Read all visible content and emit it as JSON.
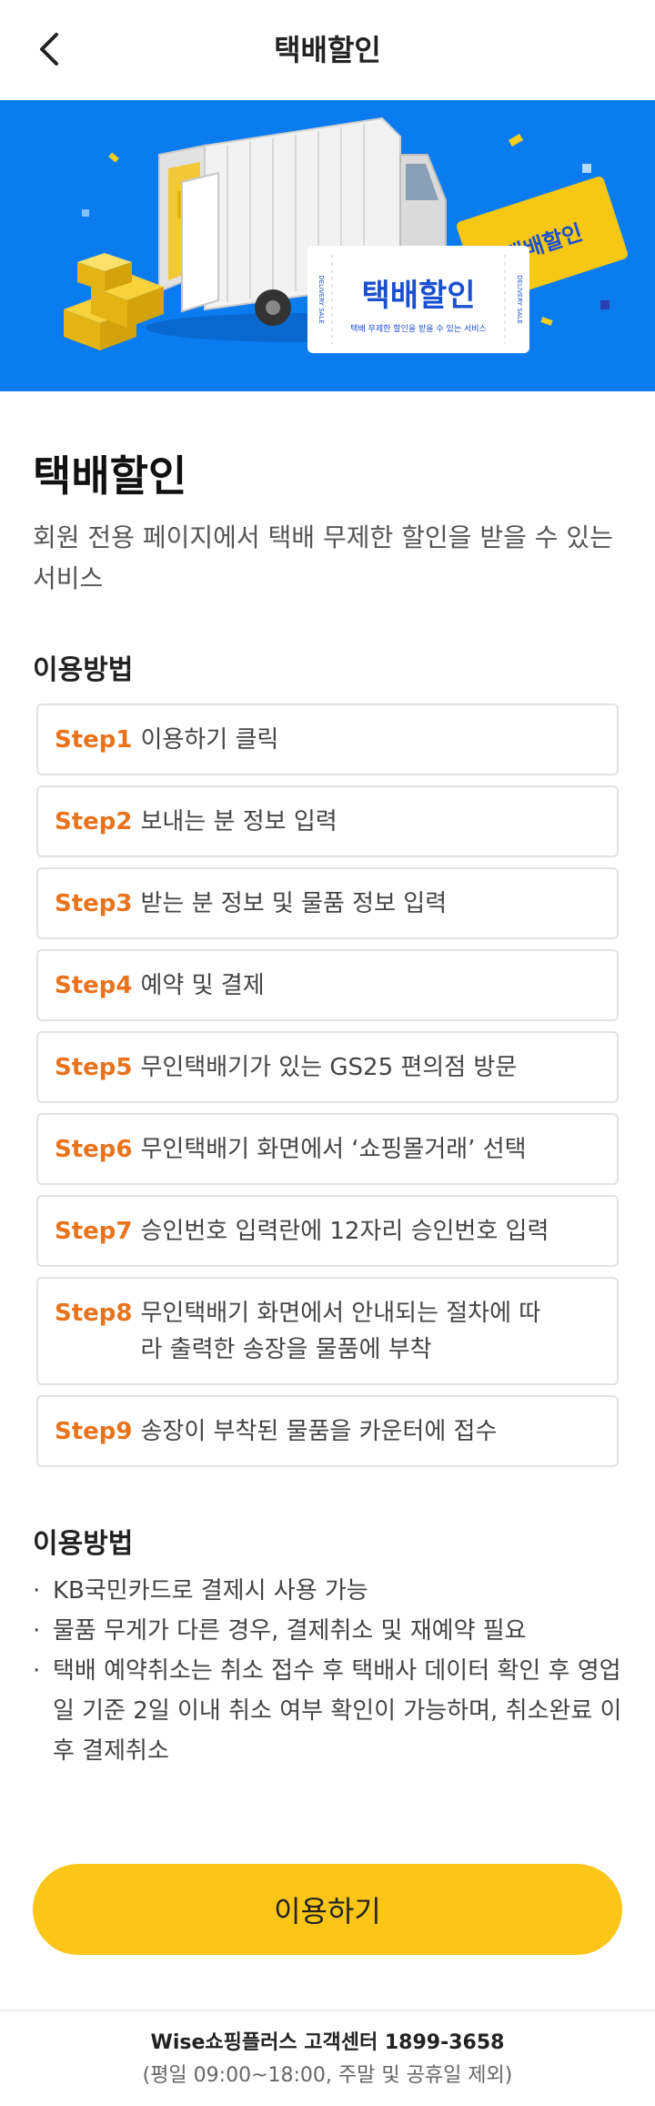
{
  "header": {
    "title": "택배할인"
  },
  "banner": {
    "ticket_main_title": "택배할인",
    "ticket_main_sub": "택배 무제한 할인을 받을 수 있는 서비스",
    "ticket_side": "DELIVERY SALE",
    "ticket_yellow": "택배할인"
  },
  "intro": {
    "title": "택배할인",
    "description": "회원 전용 페이지에서 택배 무제한 할인을 받을 수 있는 서비스"
  },
  "usage": {
    "title": "이용방법",
    "steps": [
      {
        "label": "Step1",
        "text": "이용하기 클릭"
      },
      {
        "label": "Step2",
        "text": "보내는 분 정보 입력"
      },
      {
        "label": "Step3",
        "text": "받는 분 정보 및 물품 정보 입력"
      },
      {
        "label": "Step4",
        "text": "예약 및 결제"
      },
      {
        "label": "Step5",
        "text": "무인택배기가 있는 GS25 편의점 방문"
      },
      {
        "label": "Step6",
        "text": "무인택배기 화면에서 ‘쇼핑몰거래’ 선택"
      },
      {
        "label": "Step7",
        "text": "승인번호 입력란에 12자리 승인번호 입력"
      },
      {
        "label": "Step8",
        "text": "무인택배기 화면에서 안내되는 절차에 따라 출력한 송장을 물품에 부착"
      },
      {
        "label": "Step9",
        "text": "송장이 부착된 물품을 카운터에 접수"
      }
    ]
  },
  "notes": {
    "title": "이용방법",
    "bullet": "·",
    "items": [
      "KB국민카드로 결제시 사용 가능",
      "물품 무게가 다른 경우, 결제취소 및 재예약 필요",
      "택배 예약취소는 취소 접수 후 택배사 데이터 확인 후 영업일 기준 2일 이내 취소 여부 확인이 가능하며, 취소완료 이후 결제취소"
    ]
  },
  "cta": {
    "label": "이용하기"
  },
  "footer": {
    "line1": "Wise쇼핑플러스 고객센터 1899-3658",
    "line2": "(평일 09:00~18:00, 주말 및 공휴일 제외)"
  },
  "colors": {
    "accent": "#fcc619",
    "step_label": "#e8731c",
    "banner_bg": "#0a7cf0"
  }
}
